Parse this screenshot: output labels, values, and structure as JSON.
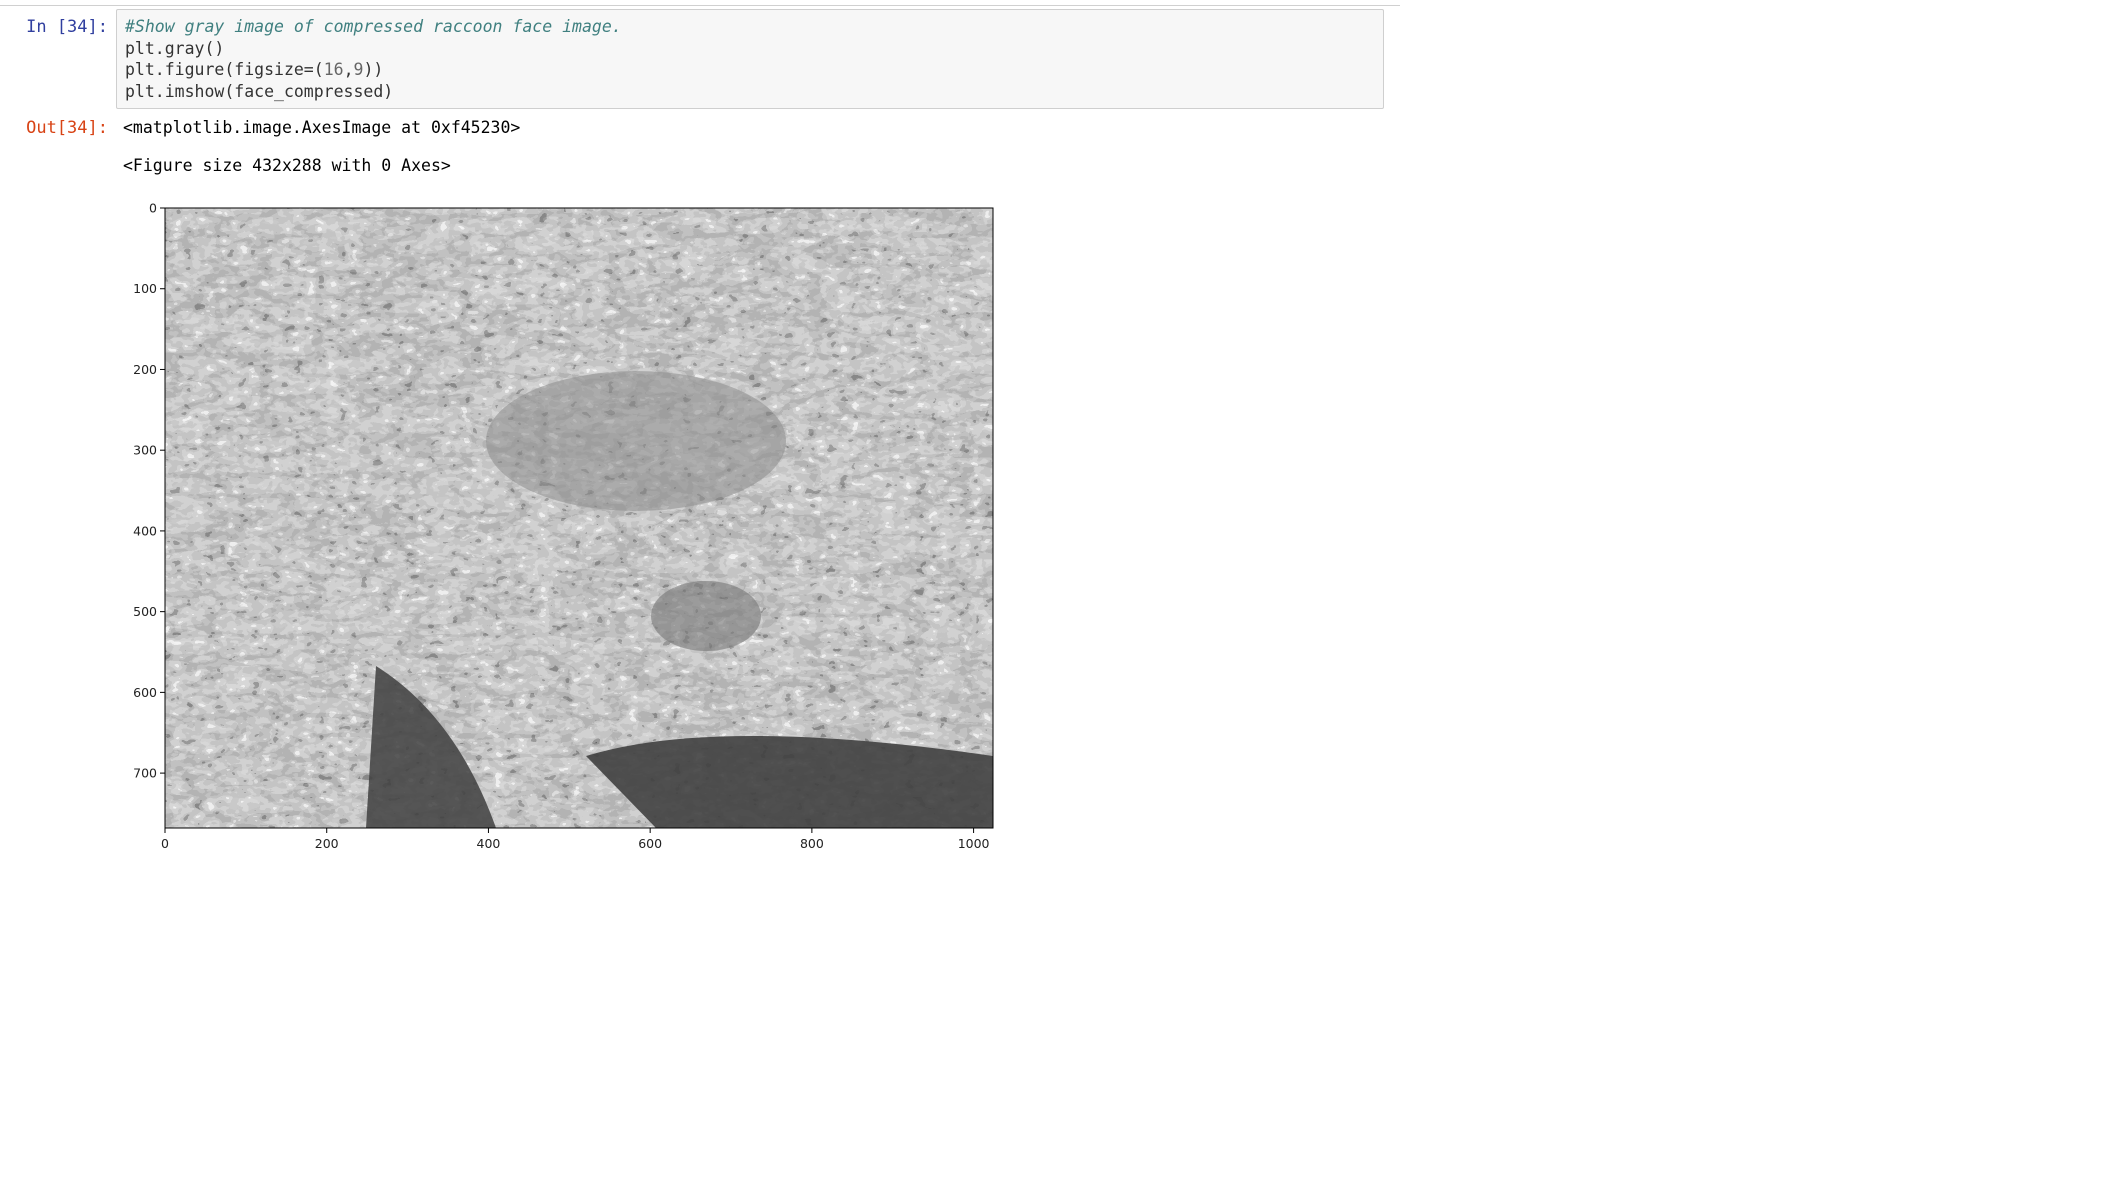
{
  "cell": {
    "in_prompt": "In [34]:",
    "out_prompt": "Out[34]:",
    "code": {
      "comment": "#Show gray image of compressed raccoon face image.",
      "line1": "plt.gray()",
      "line2_pre": "plt.figure(figsize=(",
      "line2_n1": "16",
      "line2_mid": ",",
      "line2_n2": "9",
      "line2_post": "))",
      "line3": "plt.imshow(face_compressed)"
    },
    "outputs": {
      "repr1": "<matplotlib.image.AxesImage at 0xf45230>",
      "repr2": "<Figure size 432x288 with 0 Axes>"
    }
  },
  "plot": {
    "description_label": "imshow",
    "x_ticks": [
      "0",
      "200",
      "400",
      "600",
      "800",
      "1000"
    ],
    "y_ticks": [
      "0",
      "100",
      "200",
      "300",
      "400",
      "500",
      "600",
      "700"
    ],
    "colormap": "gray"
  }
}
